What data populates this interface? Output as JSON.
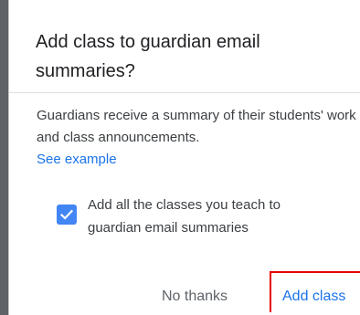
{
  "dialog": {
    "title": "Add class to guardian email summaries?",
    "body": "Guardians receive a summary of their students' work and class announcements.",
    "link_label": "See example",
    "checkbox": {
      "checked": true,
      "label": "Add all the classes you teach to guardian email summaries"
    },
    "buttons": {
      "cancel_label": "No thanks",
      "confirm_label": "Add class"
    }
  },
  "colors": {
    "accent": "#1a73e8",
    "checkbox_fill": "#4285f4",
    "highlight_outline": "#e60000"
  },
  "icons": {
    "checkbox_mark": "check-icon"
  }
}
